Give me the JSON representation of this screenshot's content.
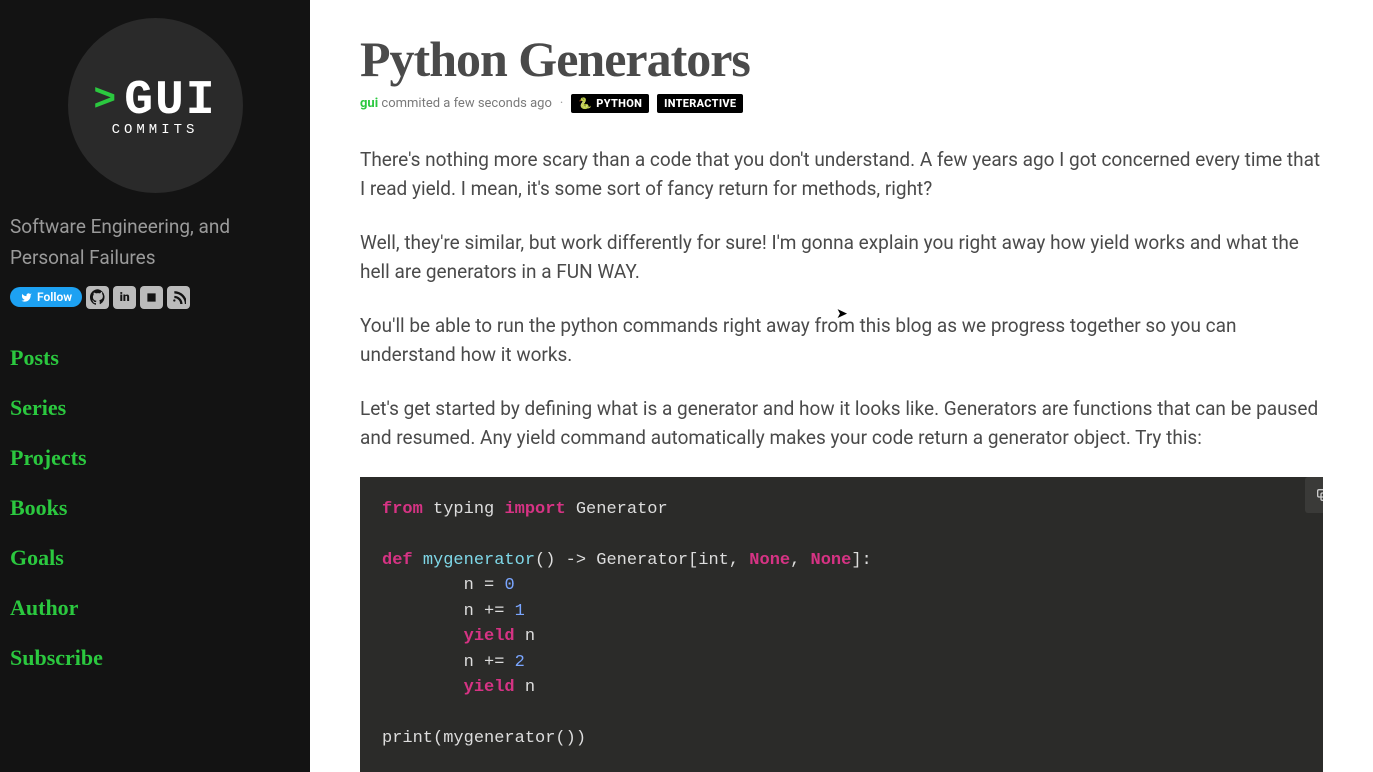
{
  "logo": {
    "prompt": ">",
    "title": "GUI",
    "subtitle": "COMMITS"
  },
  "tagline": "Software Engineering, and Personal Failures",
  "social": {
    "twitter_label": "Follow",
    "github": "gh",
    "linkedin": "in",
    "youtube": "▶",
    "rss": "rss"
  },
  "nav": [
    "Posts",
    "Series",
    "Projects",
    "Books",
    "Goals",
    "Author",
    "Subscribe"
  ],
  "post": {
    "title": "Python Generators",
    "author": "gui",
    "time_text": "commited a few seconds ago",
    "dot": "·",
    "tags": {
      "python": "PYTHON",
      "interactive": "INTERACTIVE"
    },
    "paragraphs": [
      "There's nothing more scary than a code that you don't understand. A few years ago I got concerned every time that I read yield. I mean, it's some sort of fancy return for methods, right?",
      "Well, they're similar, but work differently for sure! I'm gonna explain you right away how yield works and what the hell are generators in a FUN WAY.",
      "You'll be able to run the python commands right away from this blog as we progress together so you can understand how it works.",
      "Let's get started by defining what is a generator and how it looks like. Generators are functions that can be paused and resumed. Any yield command automatically makes your code return a generator object. Try this:"
    ],
    "code": {
      "l1": {
        "from": "from",
        "mod": "typing",
        "import": "import",
        "name": "Generator"
      },
      "l3": {
        "def": "def",
        "fn": "mygenerator",
        "arrow": "() -> ",
        "g": "Generator",
        "ob": "[",
        "int": "int",
        "c1": ", ",
        "n1": "None",
        "c2": ", ",
        "n2": "None",
        "cb": "]:",
        "indent": "        "
      },
      "l4": {
        "txt": "n = ",
        "num": "0"
      },
      "l5": {
        "txt": "n += ",
        "num": "1"
      },
      "l6": {
        "kw": "yield",
        "txt": " n"
      },
      "l7": {
        "txt": "n += ",
        "num": "2"
      },
      "l8": {
        "kw": "yield",
        "txt": " n"
      },
      "l10": {
        "txt": "print(mygenerator())"
      }
    }
  }
}
